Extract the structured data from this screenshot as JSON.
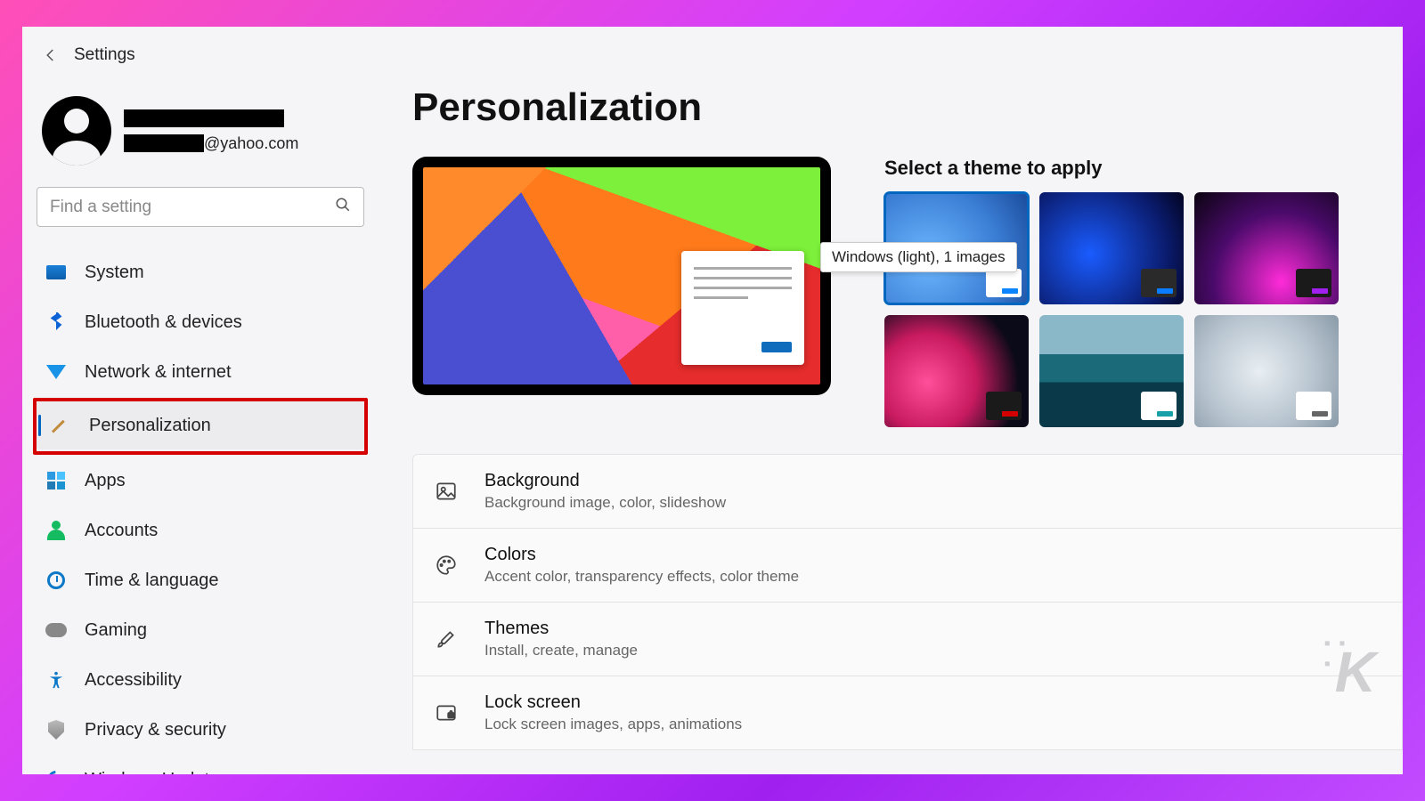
{
  "app_title": "Settings",
  "user": {
    "email_suffix": "@yahoo.com"
  },
  "search_placeholder": "Find a setting",
  "nav": [
    {
      "id": "system",
      "label": "System"
    },
    {
      "id": "bluetooth",
      "label": "Bluetooth & devices"
    },
    {
      "id": "network",
      "label": "Network & internet"
    },
    {
      "id": "personalization",
      "label": "Personalization",
      "selected": true,
      "highlighted": true
    },
    {
      "id": "apps",
      "label": "Apps"
    },
    {
      "id": "accounts",
      "label": "Accounts"
    },
    {
      "id": "time",
      "label": "Time & language"
    },
    {
      "id": "gaming",
      "label": "Gaming"
    },
    {
      "id": "accessibility",
      "label": "Accessibility"
    },
    {
      "id": "privacy",
      "label": "Privacy & security"
    },
    {
      "id": "update",
      "label": "Windows Update"
    }
  ],
  "page_title": "Personalization",
  "theme_heading": "Select a theme to apply",
  "theme_tooltip": "Windows (light), 1 images",
  "themes": [
    {
      "id": "windows-light",
      "selected": true,
      "accent": "#0a84ff"
    },
    {
      "id": "windows-dark",
      "accent": "#0a7cff"
    },
    {
      "id": "glow",
      "accent": "#a020f0"
    },
    {
      "id": "captured-motion",
      "accent": "#d40000"
    },
    {
      "id": "sunrise",
      "accent": "#18a0a8"
    },
    {
      "id": "flow",
      "accent": "#666"
    }
  ],
  "settings": [
    {
      "id": "background",
      "title": "Background",
      "sub": "Background image, color, slideshow",
      "icon": "picture"
    },
    {
      "id": "colors",
      "title": "Colors",
      "sub": "Accent color, transparency effects, color theme",
      "icon": "palette"
    },
    {
      "id": "themes",
      "title": "Themes",
      "sub": "Install, create, manage",
      "icon": "brush"
    },
    {
      "id": "lockscreen",
      "title": "Lock screen",
      "sub": "Lock screen images, apps, animations",
      "icon": "lock"
    }
  ]
}
